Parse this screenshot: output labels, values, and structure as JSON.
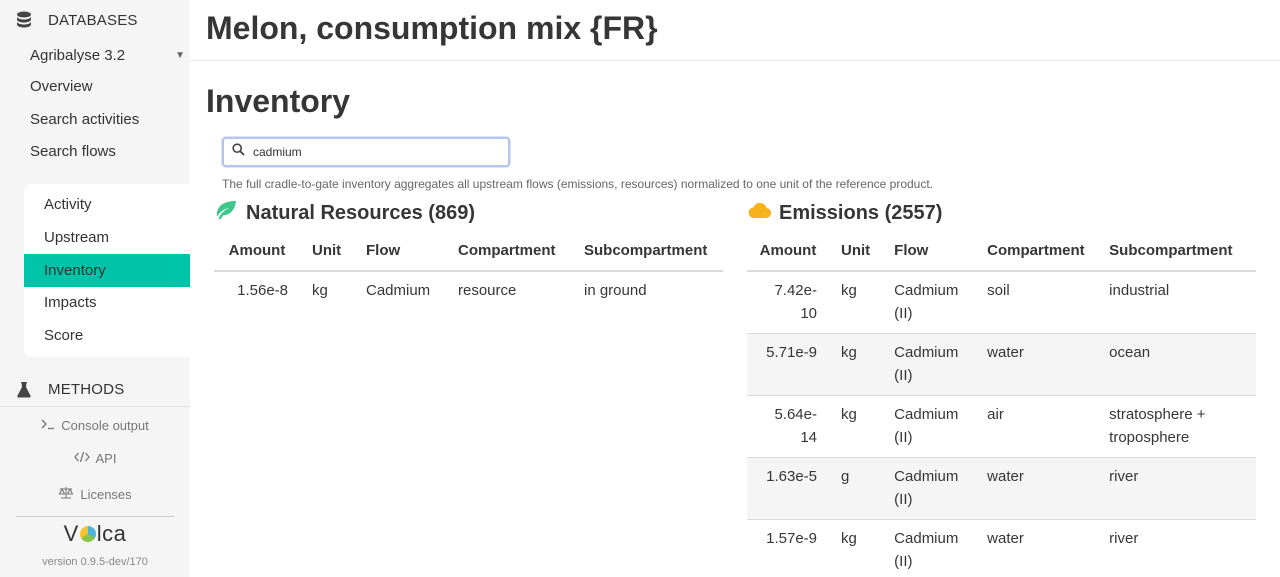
{
  "sidebar": {
    "databases_label": "DATABASES",
    "selected_db": "Agribalyse 3.2",
    "links": [
      "Overview",
      "Search activities",
      "Search flows"
    ],
    "subnav": [
      "Activity",
      "Upstream",
      "Inventory",
      "Impacts",
      "Score"
    ],
    "active_subnav": "Inventory",
    "methods_label": "METHODS",
    "console_label": "Console output",
    "api_label": "API",
    "licenses_label": "Licenses",
    "logo_prefix": "V",
    "logo_suffix": "lca",
    "version": "version 0.9.5-dev/170"
  },
  "page": {
    "title": "Melon, consumption mix {FR}",
    "section": "Inventory",
    "search_value": "cadmium",
    "help_text": "The full cradle-to-gate inventory aggregates all upstream flows (emissions, resources) normalized to one unit of the reference product."
  },
  "natural_resources": {
    "title": "Natural Resources (869)",
    "headers": [
      "Amount",
      "Unit",
      "Flow",
      "Compartment",
      "Subcompartment"
    ],
    "rows": [
      [
        "1.56e-8",
        "kg",
        "Cadmium",
        "resource",
        "in ground"
      ]
    ]
  },
  "emissions": {
    "title": "Emissions (2557)",
    "headers": [
      "Amount",
      "Unit",
      "Flow",
      "Compartment",
      "Subcompartment"
    ],
    "rows": [
      [
        "7.42e-10",
        "kg",
        "Cadmium (II)",
        "soil",
        "industrial"
      ],
      [
        "5.71e-9",
        "kg",
        "Cadmium (II)",
        "water",
        "ocean"
      ],
      [
        "5.64e-14",
        "kg",
        "Cadmium (II)",
        "air",
        "stratosphere + troposphere"
      ],
      [
        "1.63e-5",
        "g",
        "Cadmium (II)",
        "water",
        "river"
      ],
      [
        "1.57e-9",
        "kg",
        "Cadmium (II)",
        "water",
        "river"
      ]
    ]
  },
  "colors": {
    "accent": "#00c4a7",
    "leaf_icon": "#3ec78a",
    "cloud_icon": "#f6b21b"
  }
}
